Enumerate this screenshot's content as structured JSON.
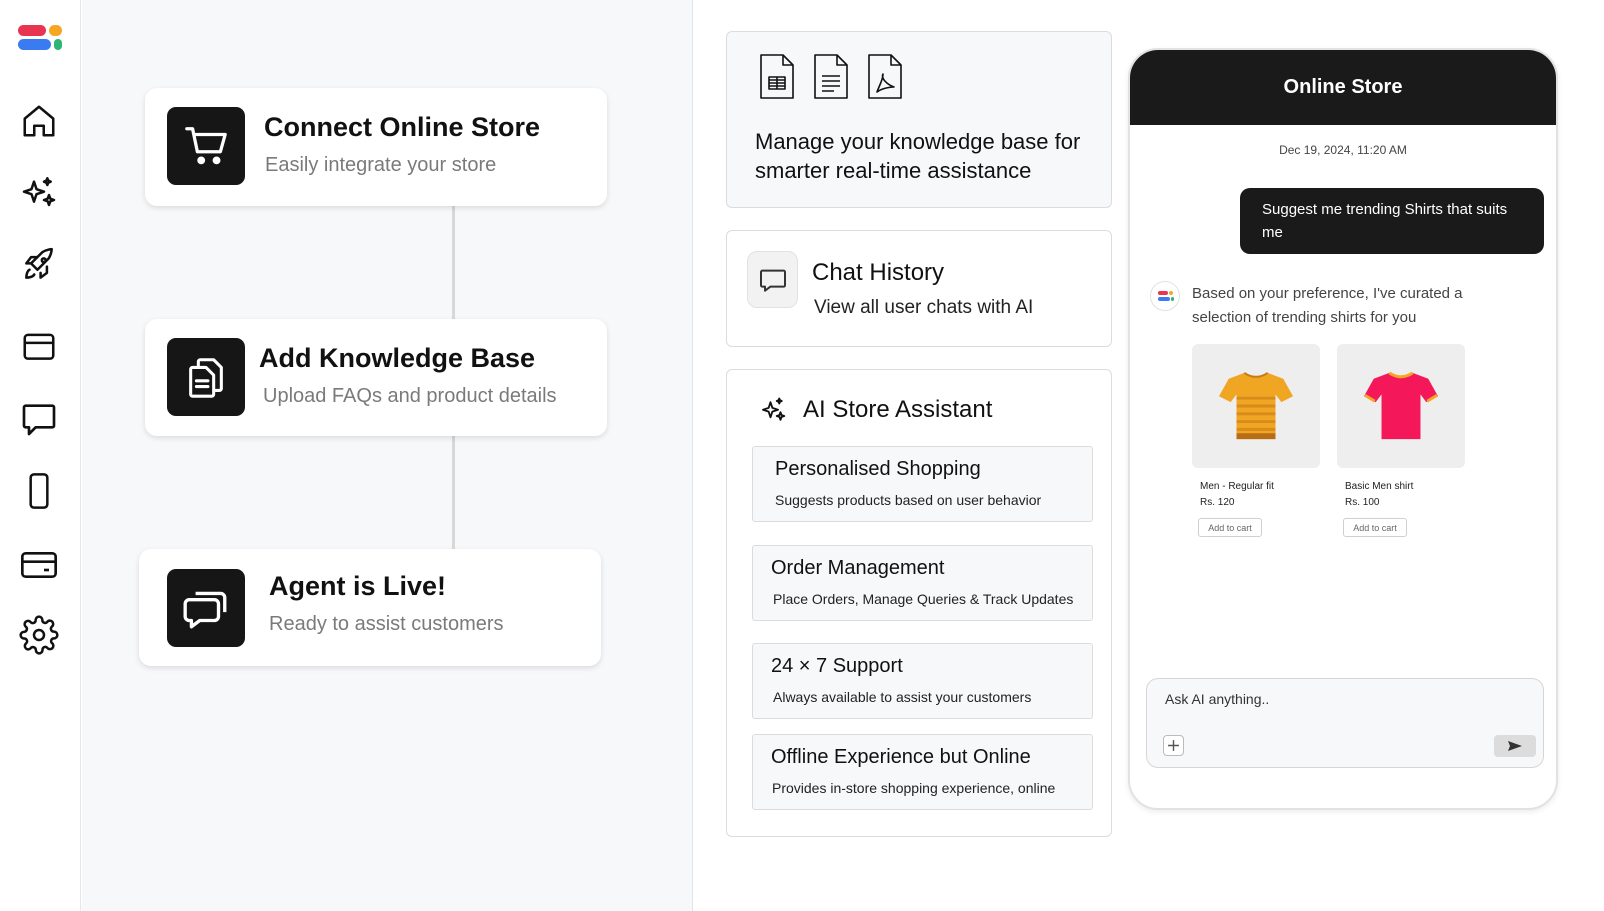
{
  "sidebar": {
    "logo_colors": [
      "#e8344e",
      "#f5a623",
      "#3b7bf2",
      "#2bb673"
    ],
    "items": [
      {
        "icon": "home-icon"
      },
      {
        "icon": "sparkles-icon"
      },
      {
        "icon": "rocket-icon"
      },
      {
        "icon": "folder-icon"
      },
      {
        "icon": "chat-icon"
      },
      {
        "icon": "mobile-icon"
      },
      {
        "icon": "credit-card-icon"
      },
      {
        "icon": "settings-icon"
      }
    ]
  },
  "flow": {
    "steps": [
      {
        "title": "Connect Online Store",
        "subtitle": "Easily integrate your store",
        "icon": "cart-icon"
      },
      {
        "title": "Add Knowledge Base",
        "subtitle": "Upload FAQs and product details",
        "icon": "documents-icon"
      },
      {
        "title": "Agent is Live!",
        "subtitle": "Ready to assist customers",
        "icon": "chat-bubbles-icon"
      }
    ]
  },
  "knowledge_base": {
    "icons": [
      "spreadsheet-file-icon",
      "text-file-icon",
      "pdf-file-icon"
    ],
    "text": "Manage your knowledge base for smarter real-time assistance"
  },
  "chat_history": {
    "title": "Chat History",
    "subtitle": "View all user chats with AI"
  },
  "ai_assistant": {
    "title": "AI Store Assistant",
    "features": [
      {
        "title": "Personalised Shopping",
        "subtitle": "Suggests products based on user behavior"
      },
      {
        "title": "Order Management",
        "subtitle": "Place Orders, Manage Queries & Track Updates"
      },
      {
        "title": "24 × 7 Support",
        "subtitle": "Always available to assist your customers"
      },
      {
        "title": "Offline Experience but Online",
        "subtitle": "Provides in-store shopping experience, online"
      }
    ]
  },
  "phone": {
    "title": "Online Store",
    "timestamp": "Dec 19, 2024, 11:20 AM",
    "user_message": "Suggest me trending Shirts that suits me",
    "bot_message": "Based on your preference, I've curated a selection of trending shirts for you",
    "products": [
      {
        "name": "Men - Regular fit",
        "price": "Rs. 120",
        "button": "Add to cart",
        "color": "#f0a623"
      },
      {
        "name": "Basic Men shirt",
        "price": "Rs. 100",
        "button": "Add to cart",
        "color": "#f4185a"
      }
    ],
    "input_placeholder": "Ask AI anything.."
  }
}
